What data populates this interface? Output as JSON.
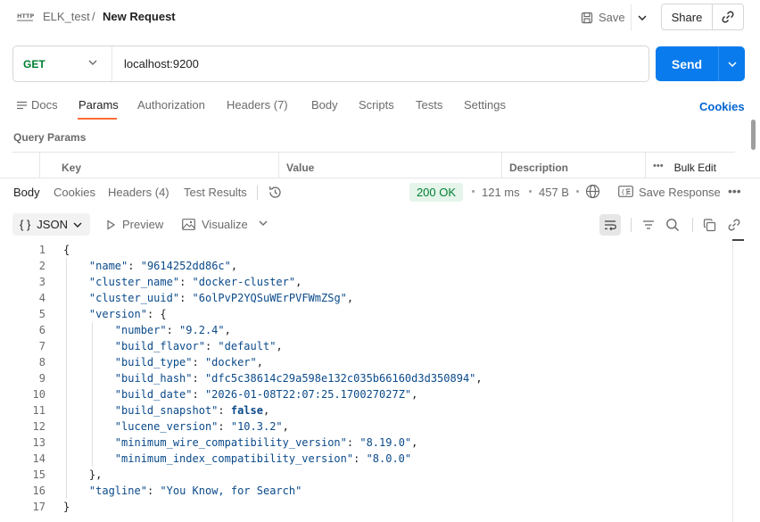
{
  "header": {
    "http_badge": "HTTP",
    "collection": "ELK_test",
    "separator": "/",
    "title": "New Request",
    "save_label": "Save",
    "share_label": "Share"
  },
  "request": {
    "method": "GET",
    "url": "localhost:9200",
    "send_label": "Send"
  },
  "request_tabs": {
    "docs": "Docs",
    "params": "Params",
    "authorization": "Authorization",
    "headers": "Headers (7)",
    "body": "Body",
    "scripts": "Scripts",
    "tests": "Tests",
    "settings": "Settings",
    "cookies": "Cookies"
  },
  "query_params": {
    "title": "Query Params",
    "columns": {
      "key": "Key",
      "value": "Value",
      "description": "Description"
    },
    "bulk_edit": "Bulk Edit"
  },
  "response": {
    "tabs": {
      "body": "Body",
      "cookies": "Cookies",
      "headers": "Headers (4)",
      "test_results": "Test Results"
    },
    "status": "200 OK",
    "time": "121 ms",
    "size": "457 B",
    "save_response": "Save Response",
    "format": "JSON",
    "preview": "Preview",
    "visualize": "Visualize"
  },
  "code": {
    "n1": "1",
    "n2": "2",
    "n3": "3",
    "n4": "4",
    "n5": "5",
    "n6": "6",
    "n7": "7",
    "n8": "8",
    "n9": "9",
    "n10": "10",
    "n11": "11",
    "n12": "12",
    "n13": "13",
    "n14": "14",
    "n15": "15",
    "n16": "16",
    "n17": "17",
    "open_brace": "{",
    "k_name": "\"name\"",
    "v_name": "\"9614252dd86c\"",
    "k_cluster_name": "\"cluster_name\"",
    "v_cluster_name": "\"docker-cluster\"",
    "k_cluster_uuid": "\"cluster_uuid\"",
    "v_cluster_uuid": "\"6olPvP2YQSuWErPVFWmZSg\"",
    "k_version": "\"version\"",
    "v_version_open": "{",
    "k_number": "\"number\"",
    "v_number": "\"9.2.4\"",
    "k_build_flavor": "\"build_flavor\"",
    "v_build_flavor": "\"default\"",
    "k_build_type": "\"build_type\"",
    "v_build_type": "\"docker\"",
    "k_build_hash": "\"build_hash\"",
    "v_build_hash": "\"dfc5c38614c29a598e132c035b66160d3d350894\"",
    "k_build_date": "\"build_date\"",
    "v_build_date": "\"2026-01-08T22:07:25.170027027Z\"",
    "k_build_snapshot": "\"build_snapshot\"",
    "v_build_snapshot": "false",
    "k_lucene_version": "\"lucene_version\"",
    "v_lucene_version": "\"10.3.2\"",
    "k_min_wire": "\"minimum_wire_compatibility_version\"",
    "v_min_wire": "\"8.19.0\"",
    "k_min_index": "\"minimum_index_compatibility_version\"",
    "v_min_index": "\"8.0.0\"",
    "close_version": "},",
    "k_tagline": "\"tagline\"",
    "v_tagline": "\"You Know, for Search\"",
    "close_brace": "}"
  }
}
